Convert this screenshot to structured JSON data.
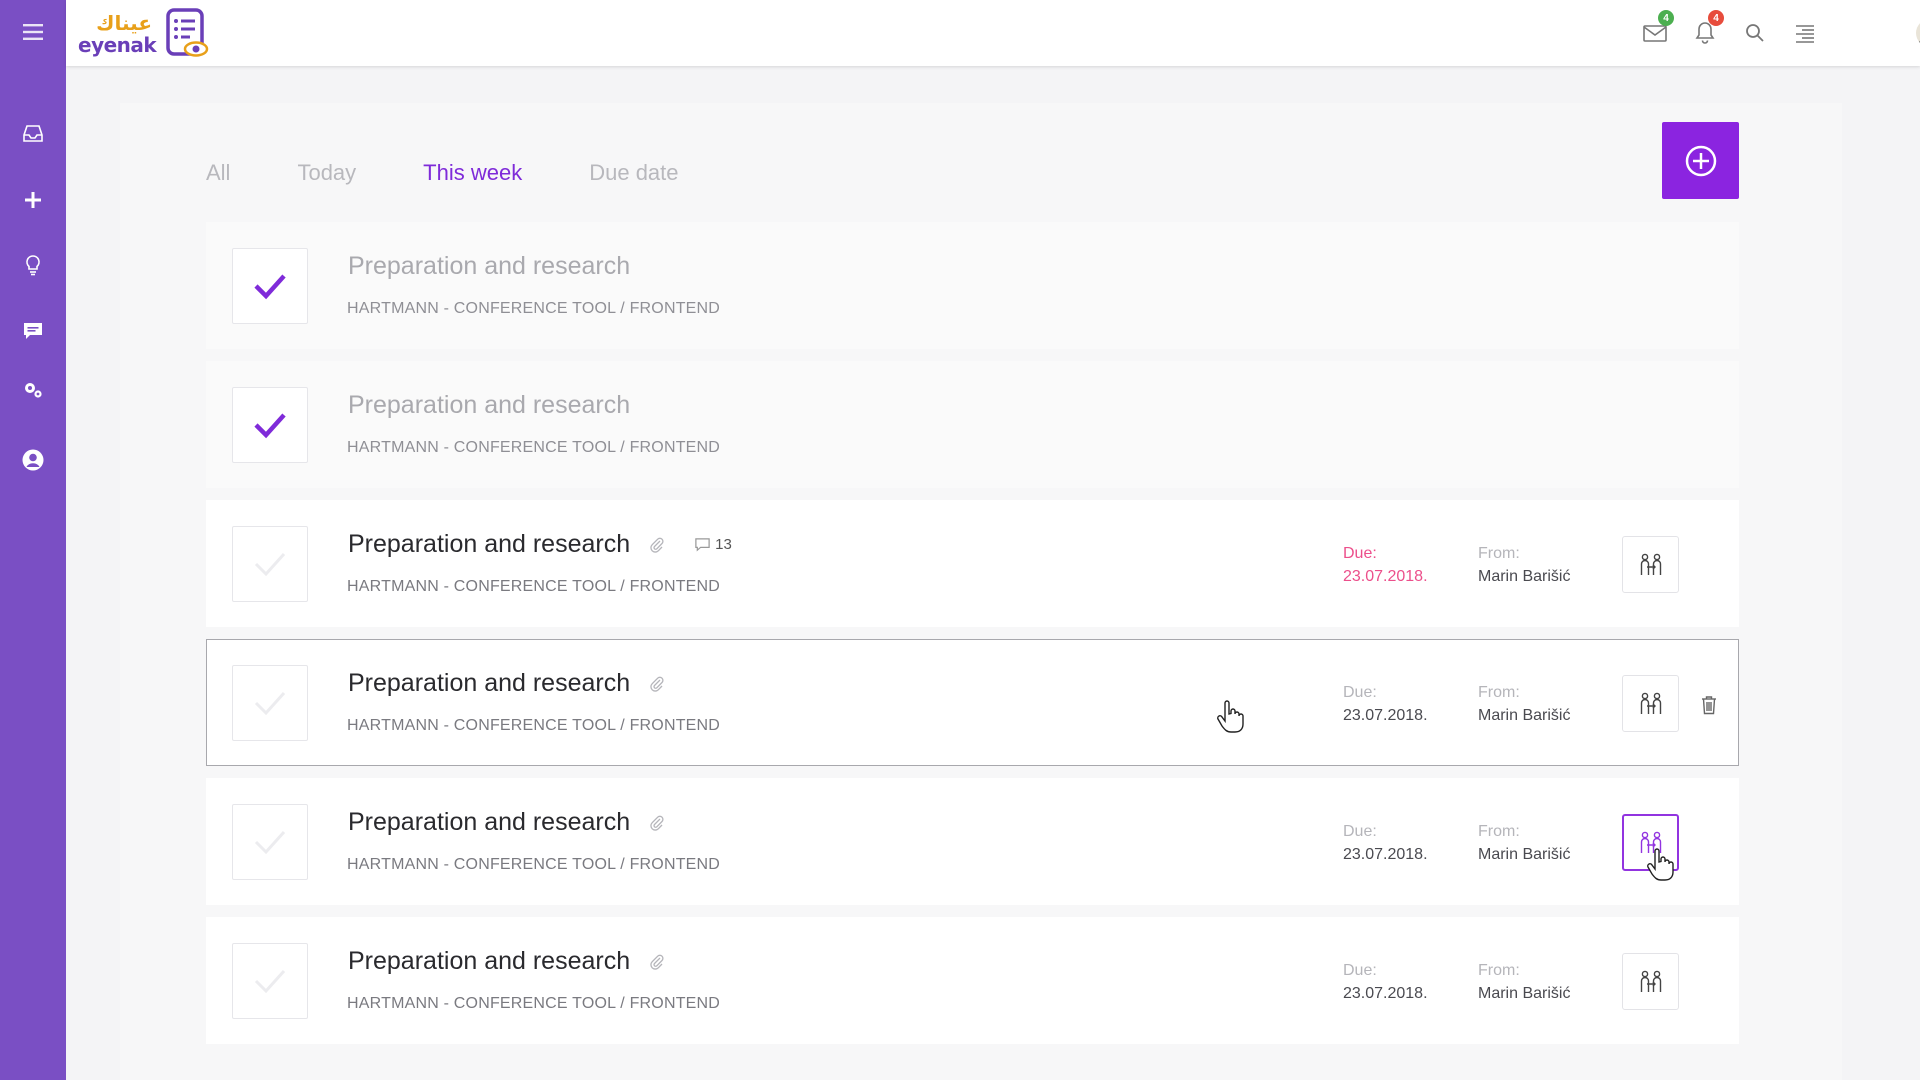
{
  "app": {
    "logo_arabic": "عيناك",
    "logo_text": "eyenak"
  },
  "colors": {
    "sidebar": "#7a4fc4",
    "accent": "#8b24e0",
    "active_tab": "#7f2bd9",
    "overdue": "#ec4f8b",
    "badge_green": "#4caf50",
    "badge_red": "#e74c3c"
  },
  "sidebar": {
    "items": [
      {
        "name": "inbox-icon"
      },
      {
        "name": "plus-icon"
      },
      {
        "name": "lightbulb-icon"
      },
      {
        "name": "chat-icon"
      },
      {
        "name": "gears-icon"
      },
      {
        "name": "user-circle-icon"
      }
    ]
  },
  "topbar": {
    "mail_badge": "4",
    "notifications_badge": "4"
  },
  "tabs": [
    {
      "label": "All",
      "active": false
    },
    {
      "label": "Today",
      "active": false
    },
    {
      "label": "This week",
      "active": true
    },
    {
      "label": "Due date",
      "active": false
    }
  ],
  "tasks": [
    {
      "title": "Preparation and research",
      "project": "HARTMANN - CONFERENCE TOOL / FRONTEND",
      "done": true
    },
    {
      "title": "Preparation and research",
      "project": "HARTMANN - CONFERENCE TOOL / FRONTEND",
      "done": true
    },
    {
      "title": "Preparation and research",
      "project": "HARTMANN - CONFERENCE TOOL / FRONTEND",
      "done": false,
      "attachment": true,
      "comments": "13",
      "due_label": "Due:",
      "due_date": "23.07.2018.",
      "overdue": true,
      "from_label": "From:",
      "from_name": "Marin Barišić"
    },
    {
      "title": "Preparation and research",
      "project": "HARTMANN - CONFERENCE TOOL / FRONTEND",
      "done": false,
      "attachment": true,
      "due_label": "Due:",
      "due_date": "23.07.2018.",
      "from_label": "From:",
      "from_name": "Marin Barišić",
      "hovered": true
    },
    {
      "title": "Preparation and research",
      "project": "HARTMANN - CONFERENCE TOOL / FRONTEND",
      "done": false,
      "attachment": true,
      "due_label": "Due:",
      "due_date": "23.07.2018.",
      "from_label": "From:",
      "from_name": "Marin Barišić",
      "assign_active": true
    },
    {
      "title": "Preparation and research",
      "project": "HARTMANN - CONFERENCE TOOL / FRONTEND",
      "done": false,
      "attachment": true,
      "due_label": "Due:",
      "due_date": "23.07.2018.",
      "from_label": "From:",
      "from_name": "Marin Barišić"
    }
  ]
}
